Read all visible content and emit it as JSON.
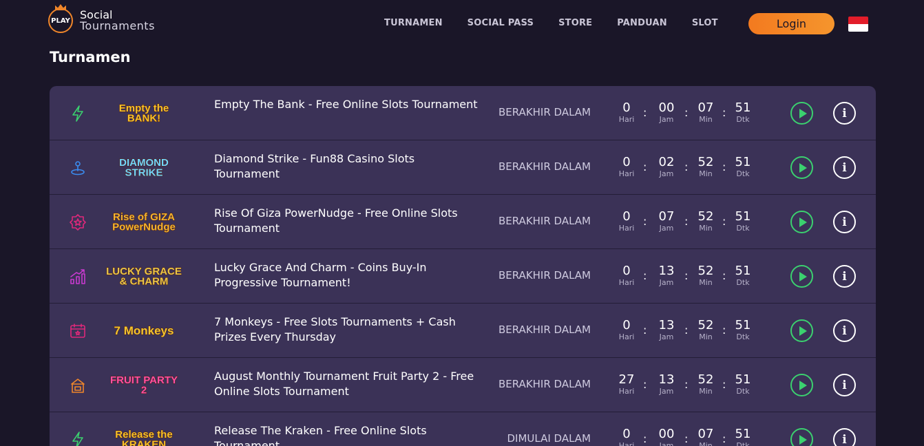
{
  "header": {
    "logo_badge": "PLAY",
    "logo_line1": "Social",
    "logo_line2": "Tournaments",
    "nav": [
      "TURNAMEN",
      "SOCIAL PASS",
      "STORE",
      "PANDUAN",
      "SLOT"
    ],
    "login_label": "Login",
    "flag": "indonesia-flag"
  },
  "page_title": "Turnamen",
  "units": {
    "days": "Hari",
    "hours": "Jam",
    "minutes": "Min",
    "seconds": "Dtk"
  },
  "tournaments": [
    {
      "icon": "lightning-icon",
      "icon_color": "#3bd16f",
      "logo": "Empty the BANK!",
      "logo_color": "#f6c22a",
      "title": "Empty The Bank - Free Online Slots Tournament",
      "status": "BERAKHIR DALAM",
      "days": "0",
      "hours": "00",
      "minutes": "07",
      "seconds": "51"
    },
    {
      "icon": "joystick-icon",
      "icon_color": "#3b8cf0",
      "logo": "DIAMOND STRIKE",
      "logo_color": "#6fd6ff",
      "title": "Diamond Strike - Fun88 Casino Slots Tournament",
      "status": "BERAKHIR DALAM",
      "days": "0",
      "hours": "02",
      "minutes": "52",
      "seconds": "51"
    },
    {
      "icon": "star-badge-icon",
      "icon_color": "#e0287a",
      "logo": "Rise of GIZA PowerNudge",
      "logo_color": "#f2b431",
      "title": "Rise Of Giza PowerNudge - Free Online Slots Tournament",
      "status": "BERAKHIR DALAM",
      "days": "0",
      "hours": "07",
      "minutes": "52",
      "seconds": "51"
    },
    {
      "icon": "bar-chart-icon",
      "icon_color": "#c93ad1",
      "logo": "LUCKY GRACE & CHARM",
      "logo_color": "#e8c64a",
      "title": "Lucky Grace And Charm - Coins Buy-In Progressive Tournament!",
      "status": "BERAKHIR DALAM",
      "days": "0",
      "hours": "13",
      "minutes": "52",
      "seconds": "51"
    },
    {
      "icon": "calendar-icon",
      "icon_color": "#e0287a",
      "logo": "7 Monkeys",
      "logo_color": "#f2c531",
      "title": "7 Monkeys - Free Slots Tournaments + Cash Prizes Every Thursday",
      "status": "BERAKHIR DALAM",
      "days": "0",
      "hours": "13",
      "minutes": "52",
      "seconds": "51"
    },
    {
      "icon": "building-icon",
      "icon_color": "#f0862a",
      "logo": "FRUIT PARTY 2",
      "logo_color": "#ff4fa8",
      "title": "August Monthly Tournament Fruit Party 2 - Free Online Slots Tournament",
      "status": "BERAKHIR DALAM",
      "days": "27",
      "hours": "13",
      "minutes": "52",
      "seconds": "51"
    },
    {
      "icon": "lightning-icon",
      "icon_color": "#3bd16f",
      "logo": "Release the KRAKEN",
      "logo_color": "#f6c22a",
      "title": "Release The Kraken - Free Online Slots Tournament",
      "status": "DIMULAI DALAM",
      "days": "0",
      "hours": "00",
      "minutes": "07",
      "seconds": "51"
    }
  ]
}
